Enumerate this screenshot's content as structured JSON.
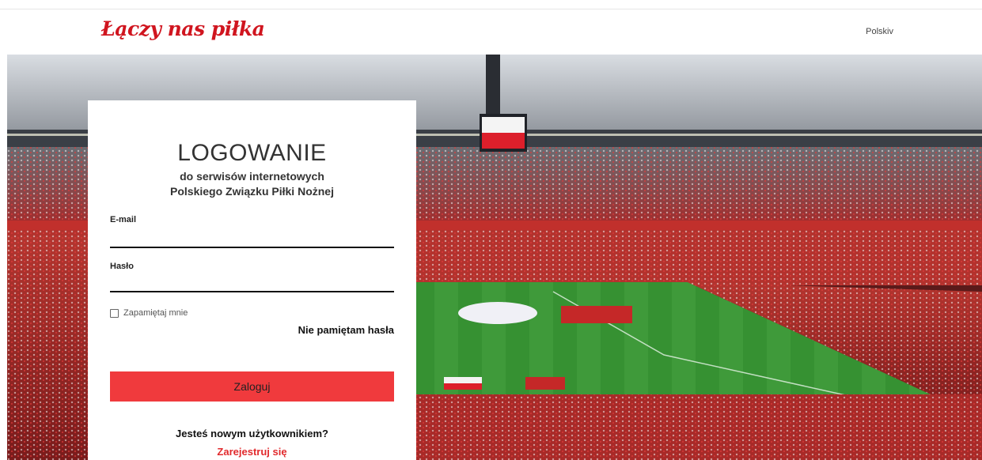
{
  "header": {
    "logo_text": "Łączy nas piłka",
    "language": "Polskiv"
  },
  "login": {
    "title": "LOGOWANIE",
    "subtitle_line1": "do serwisów internetowych",
    "subtitle_line2": "Polskiego Związku Piłki Nożnej",
    "email_label": "E-mail",
    "email_value": "",
    "password_label": "Hasło",
    "password_value": "",
    "remember_label": "Zapamiętaj mnie",
    "remember_checked": false,
    "forgot_label": "Nie pamiętam hasła",
    "submit_label": "Zaloguj",
    "new_user_text": "Jesteś nowym użytkownikiem?",
    "register_label": "Zarejestruj się"
  },
  "colors": {
    "brand_red": "#d0151f",
    "button_red": "#f03a3d",
    "link_red": "#e12a2d"
  }
}
